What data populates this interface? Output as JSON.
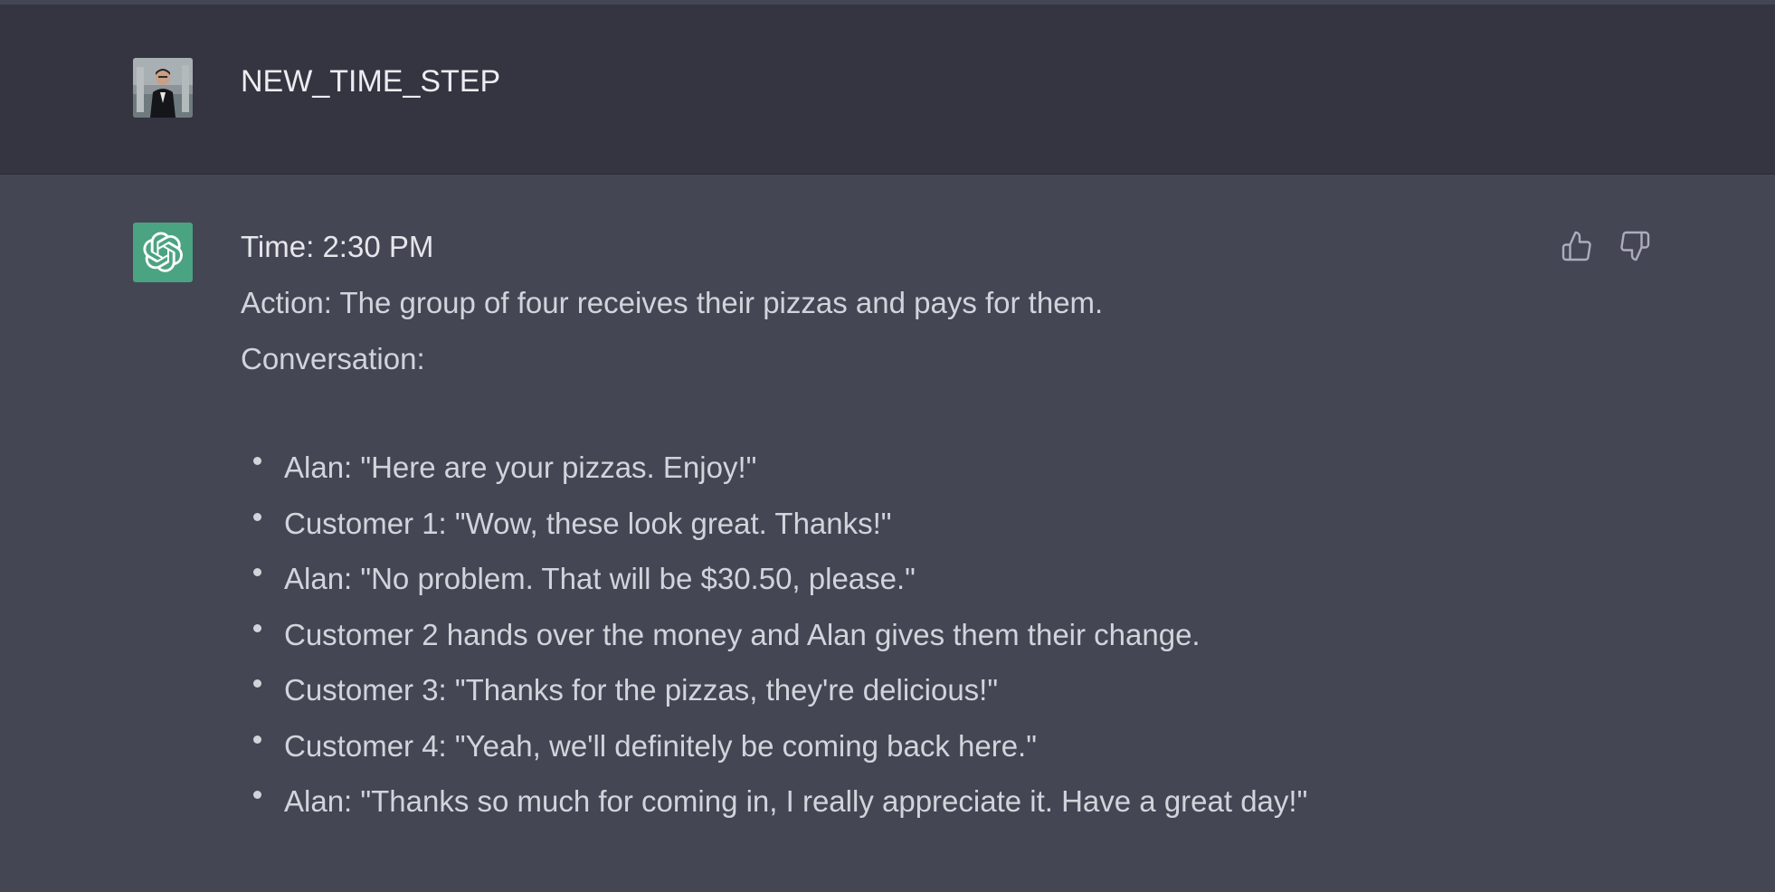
{
  "user_message": {
    "text": "NEW_TIME_STEP",
    "avatar_icon": "user-photo-avatar"
  },
  "assistant_message": {
    "logo_icon": "openai-logo-icon",
    "lines": {
      "time": "Time: 2:30 PM",
      "action": "Action: The group of four receives their pizzas and pays for them.",
      "conversation_label": "Conversation:"
    },
    "bullets": [
      "Alan: \"Here are your pizzas. Enjoy!\"",
      "Customer 1: \"Wow, these look great. Thanks!\"",
      "Alan: \"No problem. That will be $30.50, please.\"",
      "Customer 2 hands over the money and Alan gives them their change.",
      "Customer 3: \"Thanks for the pizzas, they're delicious!\"",
      "Customer 4: \"Yeah, we'll definitely be coming back here.\"",
      "Alan: \"Thanks so much for coming in, I really appreciate it. Have a great day!\""
    ],
    "feedback": {
      "thumbs_up_icon": "thumbs-up-icon",
      "thumbs_down_icon": "thumbs-down-icon"
    }
  },
  "colors": {
    "user_row_bg": "#343541",
    "assistant_row_bg": "#444654",
    "logo_bg": "#4aa381",
    "text": "#d1d5db"
  }
}
